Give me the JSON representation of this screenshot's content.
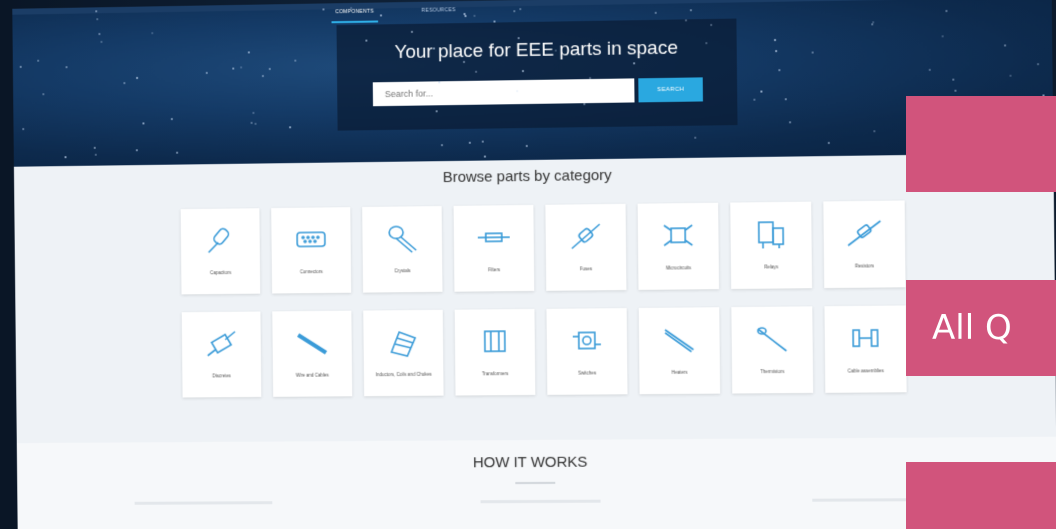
{
  "nav": {
    "tab_components": "COMPONENTS",
    "tab_second": "RESOURCES"
  },
  "hero": {
    "title": "Your place for EEE parts in space",
    "search_placeholder": "Search for...",
    "search_button": "SEARCH"
  },
  "browse": {
    "title": "Browse parts by category",
    "categories": [
      {
        "label": "Capacitors",
        "icon": "capacitor-icon"
      },
      {
        "label": "Connectors",
        "icon": "connector-icon"
      },
      {
        "label": "Crystals",
        "icon": "crystal-icon"
      },
      {
        "label": "Filters",
        "icon": "filter-icon"
      },
      {
        "label": "Fuses",
        "icon": "fuse-icon"
      },
      {
        "label": "Microcircuits",
        "icon": "microcircuit-icon"
      },
      {
        "label": "Relays",
        "icon": "relay-icon"
      },
      {
        "label": "Resistors",
        "icon": "resistor-icon"
      },
      {
        "label": "Discretes",
        "icon": "discrete-icon"
      },
      {
        "label": "Wire and Cables",
        "icon": "cable-icon"
      },
      {
        "label": "Inductors, Coils and Chokes",
        "icon": "inductor-icon"
      },
      {
        "label": "Transformers",
        "icon": "transformer-icon"
      },
      {
        "label": "Switches",
        "icon": "switch-icon"
      },
      {
        "label": "Heaters",
        "icon": "heater-icon"
      },
      {
        "label": "Thermistors",
        "icon": "thermistor-icon"
      },
      {
        "label": "Cable assemblies",
        "icon": "cable-assembly-icon"
      }
    ]
  },
  "how": {
    "title": "HOW IT WORKS"
  },
  "overlay": {
    "text": "All Q",
    "color": "#d1547c"
  },
  "colors": {
    "accent": "#2aa8e0",
    "icon": "#3a9bd8"
  }
}
